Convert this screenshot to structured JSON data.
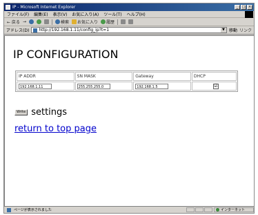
{
  "window": {
    "title": "IP - Microsoft Internet Explorer",
    "controls": [
      "_",
      "□",
      "×"
    ]
  },
  "menu": [
    "ファイル(F)",
    "編集(E)",
    "表示(V)",
    "お気に入り(A)",
    "ツール(T)",
    "ヘルプ(H)"
  ],
  "toolbar": {
    "back": "← 戻る",
    "forward": "→",
    "search": "検索",
    "favorites": "お気に入り",
    "history": "履歴"
  },
  "address": {
    "label": "アドレス(D)",
    "url": "http://192.168.1.11/config_ip?t=1",
    "go": "移動",
    "links": "リンク"
  },
  "page": {
    "heading": "IP CONFIGURATION",
    "columns": [
      "IP ADDR",
      "SN MASK",
      "Gateway",
      "DHCP"
    ],
    "values": {
      "ip_addr": "192.168.1.11",
      "sn_mask": "255.255.255.0",
      "gateway": "192.168.1.5",
      "dhcp_checked": true,
      "dhcp_mark": "☑"
    },
    "write_button": "Write",
    "settings_label": "settings",
    "return_link": "return to top page"
  },
  "status": {
    "text": "ページが表示されました",
    "zone": "インターネット"
  }
}
